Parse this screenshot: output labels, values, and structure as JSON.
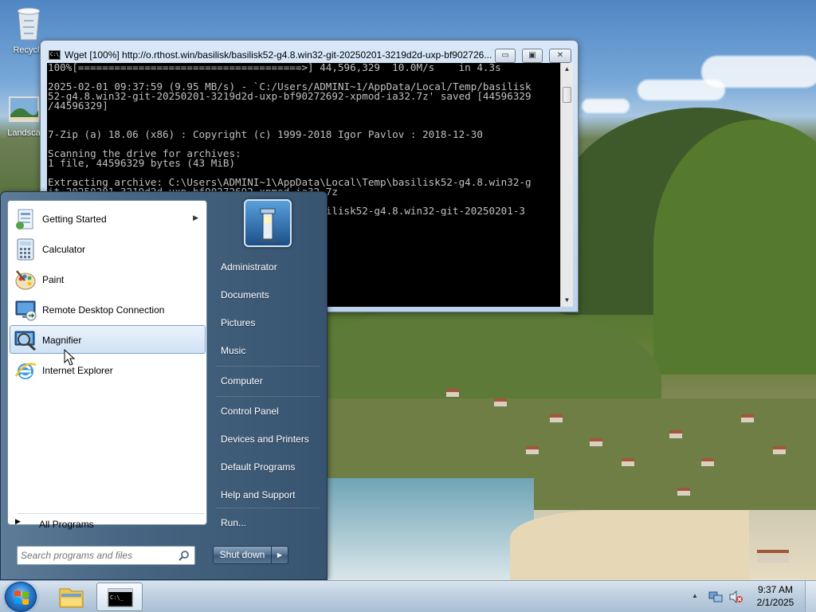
{
  "desktop": {
    "icons": [
      {
        "name": "recycle-bin",
        "label": "Recycle"
      },
      {
        "name": "landscape",
        "label": "Landsca"
      }
    ]
  },
  "console": {
    "title": "Wget [100%] http://o.rthost.win/basilisk/basilisk52-g4.8.win32-git-20250201-3219d2d-uxp-bf902726...",
    "controls": {
      "minimize": "▭",
      "maximize": "▣",
      "close": "✕"
    },
    "output": "100%[=====================================>] 44,596,329  10.0M/s    in 4.3s\n\n2025-02-01 09:37:59 (9.95 MB/s) - `C:/Users/ADMINI~1/AppData/Local/Temp/basilisk\n52-g4.8.win32-git-20250201-3219d2d-uxp-bf90272692-xpmod-ia32.7z' saved [44596329\n/44596329]\n\n\n7-Zip (a) 18.06 (x86) : Copyright (c) 1999-2018 Igor Pavlov : 2018-12-30\n\nScanning the drive for archives:\n1 file, 44596329 bytes (43 MiB)\n\nExtracting archive: C:\\Users\\ADMINI~1\\AppData\\Local\\Temp\\basilisk52-g4.8.win32-g\nit-20250201-3219d2d-uxp-bf90272692-xpmod-ia32.7z\n--\n                                           basilisk52-g4.8.win32-git-20250201-3"
  },
  "startmenu": {
    "programs": [
      {
        "label": "Getting Started",
        "icon": "getting-started-icon",
        "submenu": true
      },
      {
        "label": "Calculator",
        "icon": "calculator-icon"
      },
      {
        "label": "Paint",
        "icon": "paint-icon"
      },
      {
        "label": "Remote Desktop Connection",
        "icon": "remote-desktop-icon"
      },
      {
        "label": "Magnifier",
        "icon": "magnifier-icon",
        "highlighted": true
      },
      {
        "label": "Internet Explorer",
        "icon": "internet-explorer-icon"
      }
    ],
    "all_programs": "All Programs",
    "search_placeholder": "Search programs and files",
    "right_items": [
      "Administrator",
      "Documents",
      "Pictures",
      "Music",
      "Computer",
      "Control Panel",
      "Devices and Printers",
      "Default Programs",
      "Help and Support",
      "Run..."
    ],
    "shutdown": "Shut down"
  },
  "taskbar": {
    "clock_time": "9:37 AM",
    "clock_date": "2/1/2025",
    "pinned": [
      "windows-explorer-icon",
      "command-prompt-icon"
    ]
  },
  "colors": {
    "console_bg": "#000000",
    "console_text": "#c0c0c0",
    "startmenu_blue": "#466582",
    "highlight": "#cfe2f6"
  }
}
